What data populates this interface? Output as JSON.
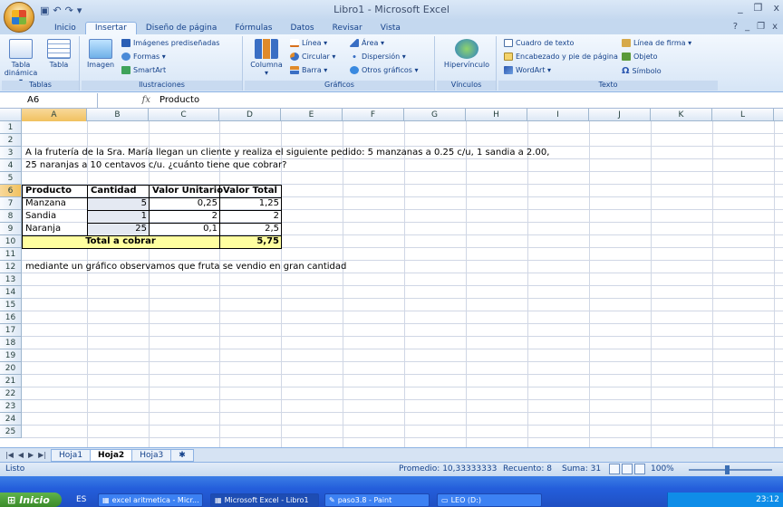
{
  "window": {
    "title": "Libro1 - Microsoft Excel"
  },
  "ribbon": {
    "tabs": [
      "Inicio",
      "Insertar",
      "Diseño de página",
      "Fórmulas",
      "Datos",
      "Revisar",
      "Vista"
    ],
    "active_tab": "Insertar",
    "groups": {
      "tablas": {
        "label": "Tablas",
        "tabla_dinamica": "Tabla dinámica ▾",
        "tabla": "Tabla"
      },
      "ilustraciones": {
        "label": "Ilustraciones",
        "imagen": "Imagen",
        "imagenes_prediseñadas": "Imágenes prediseñadas",
        "formas": "Formas ▾",
        "smartart": "SmartArt"
      },
      "graficos": {
        "label": "Gráficos",
        "columna": "Columna ▾",
        "linea": "Línea ▾",
        "circular": "Circular ▾",
        "barra": "Barra ▾",
        "area": "Área ▾",
        "dispersion": "Dispersión ▾",
        "otros": "Otros gráficos ▾"
      },
      "vinculos": {
        "label": "Vínculos",
        "hipervinculo": "Hipervínculo"
      },
      "texto": {
        "label": "Texto",
        "cuadro": "Cuadro de texto",
        "encabezado": "Encabezado y pie de página",
        "wordart": "WordArt ▾",
        "linea_firma": "Línea de firma ▾",
        "objeto": "Objeto",
        "simbolo": "Símbolo"
      }
    }
  },
  "formula_bar": {
    "name_box": "A6",
    "fx": "fx",
    "content": "Producto"
  },
  "columns": [
    "A",
    "B",
    "C",
    "D",
    "E",
    "F",
    "G",
    "H",
    "I",
    "J",
    "K",
    "L"
  ],
  "rows": [
    "1",
    "2",
    "3",
    "4",
    "5",
    "6",
    "7",
    "8",
    "9",
    "10",
    "11",
    "12",
    "13",
    "14",
    "15",
    "16",
    "17",
    "18",
    "19",
    "20",
    "21",
    "22",
    "23",
    "24",
    "25"
  ],
  "sheet": {
    "line2": "A la frutería de la Sra. María llegan un  cliente y realiza el siguiente pedido: 5 manzanas a 0.25 c/u, 1 sandia  a 2.00,",
    "line3": "25 naranjas a 10 centavos c/u. ¿cuánto tiene que cobrar?",
    "table": {
      "headers": [
        "Producto",
        "Cantidad",
        "Valor Unitario",
        "Valor Total"
      ],
      "rows": [
        [
          "Manzana",
          "5",
          "0,25",
          "1,25"
        ],
        [
          "Sandia",
          "1",
          "2",
          "2"
        ],
        [
          "Naranja",
          "25",
          "0,1",
          "2,5"
        ]
      ],
      "total_label": "Total  a cobrar",
      "total_value": "5,75"
    },
    "line12": "mediante un gráfico observamos que fruta se vendio  en gran cantidad"
  },
  "sheet_tabs": [
    "Hoja1",
    "Hoja2",
    "Hoja3"
  ],
  "active_sheet": "Hoja2",
  "status": {
    "ready": "Listo",
    "average": "Promedio: 10,33333333",
    "count": "Recuento: 8",
    "sum": "Suma: 31",
    "zoom": "100%"
  },
  "taskbar": {
    "start": "Inicio",
    "lang": "ES",
    "tasks": [
      "excel aritmetica - Micr...",
      "Microsoft Excel - Libro1",
      "paso3.8 - Paint",
      "LEO (D:)"
    ],
    "clock": "23:12"
  }
}
